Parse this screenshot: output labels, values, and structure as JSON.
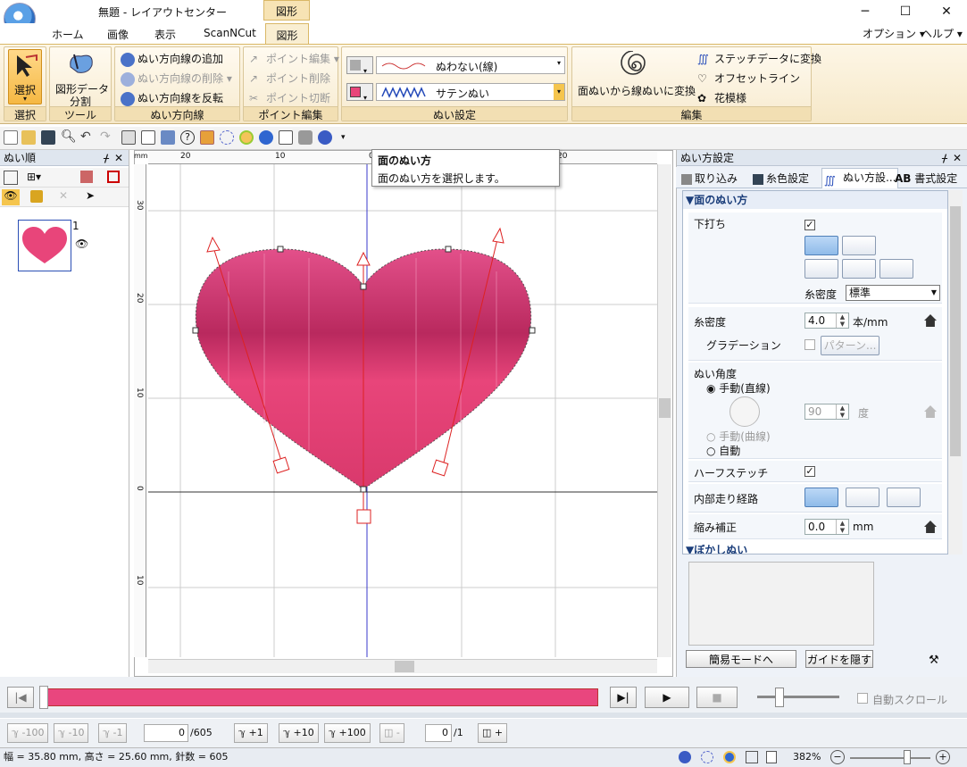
{
  "title": "無題 - レイアウトセンター",
  "context_tab": "図形",
  "window_buttons": {
    "minimize": "─",
    "maximize": "☐",
    "close": "✕"
  },
  "tabs": [
    "ホーム",
    "画像",
    "表示",
    "ScanNCut",
    "図形"
  ],
  "options_menu": "オプション",
  "help_menu": "ヘルプ",
  "ribbon": {
    "select": {
      "label": "選択",
      "group": "選択"
    },
    "tool": {
      "label_line1": "図形データ",
      "label_line2": "分割",
      "group": "ツール"
    },
    "sewdir": {
      "add": "ぬい方向線の追加",
      "delete": "ぬい方向線の削除",
      "reverse": "ぬい方向線を反転",
      "group": "ぬい方向線"
    },
    "point": {
      "edit": "ポイント編集",
      "delete": "ポイント削除",
      "cut": "ポイント切断",
      "group": "ポイント編集"
    },
    "sewset": {
      "line_type": "ぬわない(線)",
      "fill_type": "サテンぬい",
      "group": "ぬい設定"
    },
    "edit": {
      "convert": "面ぬいから線ぬいに変換",
      "stitch": "ステッチデータに変換",
      "offset": "オフセットライン",
      "flower": "花模様",
      "group": "編集"
    }
  },
  "left_panel": {
    "title": "ぬい順",
    "item_number": "1"
  },
  "tooltip": {
    "title": "面のぬい方",
    "body": "面のぬい方を選択します。"
  },
  "ruler": {
    "top_labels": [
      "mm",
      "20",
      "10",
      "0",
      "10",
      "20"
    ],
    "left_labels": [
      "30",
      "20",
      "10",
      "0",
      "10"
    ]
  },
  "right_panel": {
    "title": "ぬい方設定",
    "tabs": [
      "取り込み",
      "糸色設定",
      "ぬい方設...",
      "書式設定"
    ],
    "section": "▼面のぬい方",
    "underlay": "下打ち",
    "density_label": "糸密度",
    "density_value": "標準",
    "thread_density": "糸密度",
    "thread_density_value": "4.0",
    "thread_density_unit": "本/mm",
    "gradation": "グラデーション",
    "pattern_button": "パターン...",
    "angle": "ぬい角度",
    "manual_line": "手動(直線)",
    "angle_value": "90",
    "angle_unit": "度",
    "manual_curve": "手動(曲線)",
    "auto": "自動",
    "half_stitch": "ハーフステッチ",
    "inner_path": "内部走り経路",
    "shrink": "縮み補正",
    "shrink_value": "0.0",
    "shrink_unit": "mm",
    "blur_section": "▼ぼかしぬい",
    "easy_mode": "簡易モードへ",
    "hide_guide": "ガイドを隠す"
  },
  "playback": {
    "autoscroll": "自動スクロール"
  },
  "steps": {
    "m100": "-100",
    "m10": "-10",
    "m1": "-1",
    "stitch_pos": "0",
    "stitch_total": "/605",
    "p1": "+1",
    "p10": "+10",
    "p100": "+100",
    "frame_pos": "0",
    "frame_total": "/1",
    "minus": "-",
    "plus": "+"
  },
  "status": {
    "text": "幅 = 35.80 mm, 高さ = 25.60 mm, 針数 = 605",
    "zoom": "382%"
  },
  "colors": {
    "heart": "#e8457a",
    "progress": "#e9467e",
    "accent": "#f7e3b4"
  }
}
